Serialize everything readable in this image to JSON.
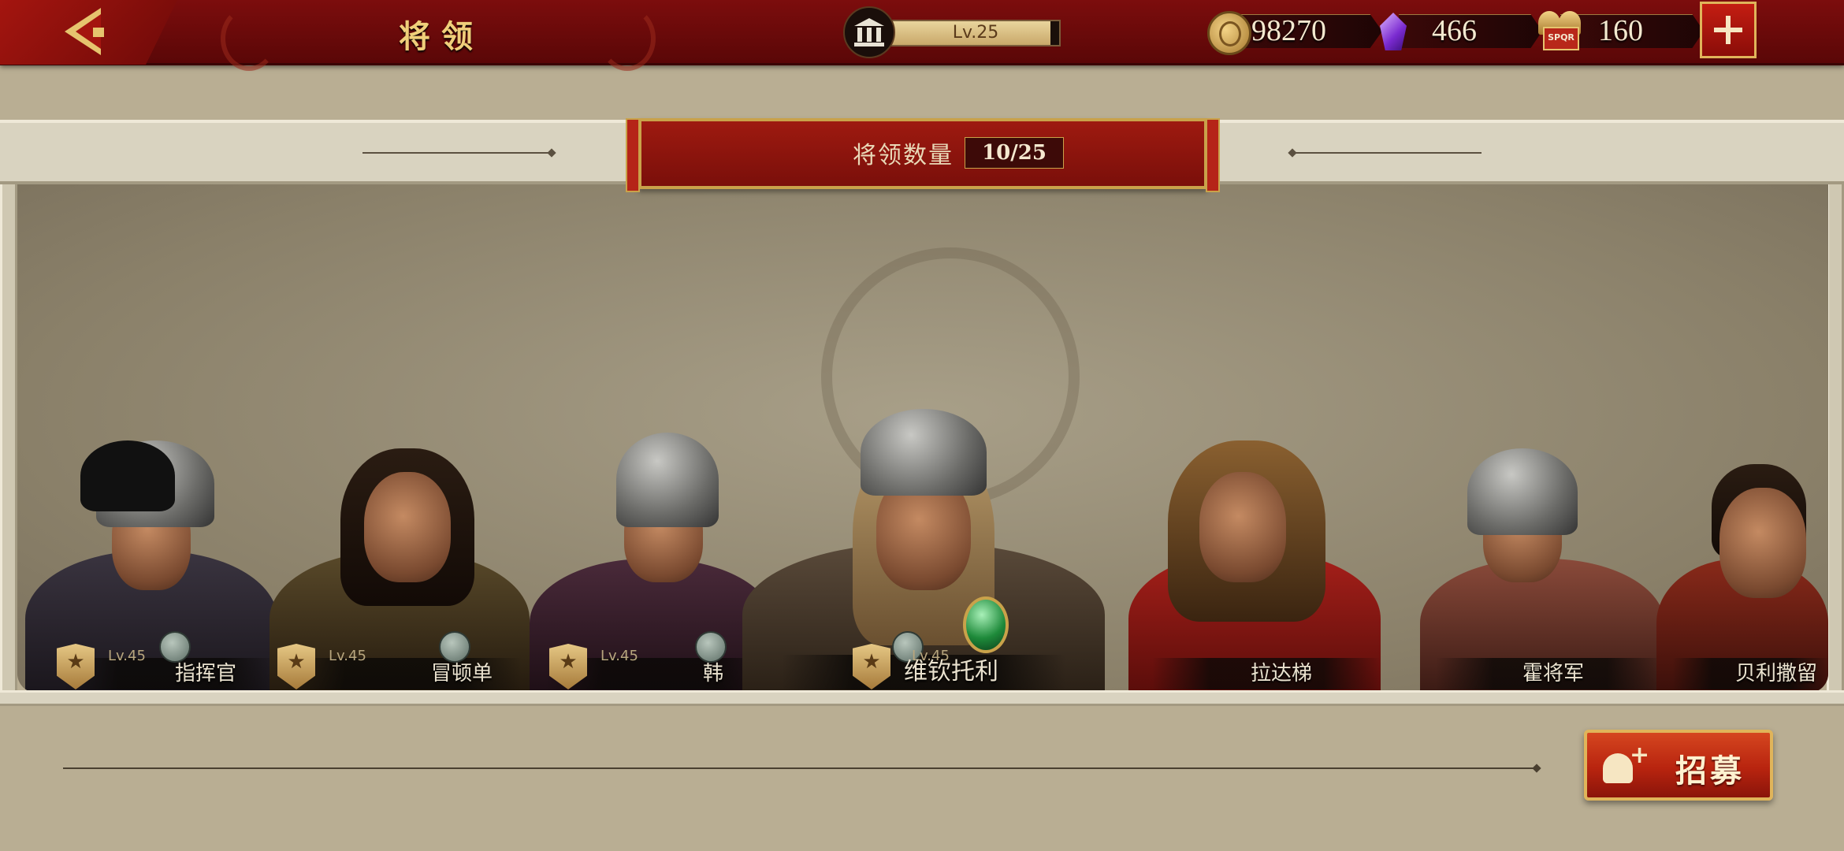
{
  "header": {
    "title": "将领",
    "level": "Lv.25",
    "level_progress": 0.95,
    "resources": [
      {
        "name": "coins",
        "icon": "coin-icon",
        "value": "98270"
      },
      {
        "name": "gems",
        "icon": "purple-gem-icon",
        "value": "466"
      },
      {
        "name": "spqr",
        "icon": "spqr-helmet-icon",
        "value": "160"
      }
    ],
    "spqr_text": "SPQR"
  },
  "banner": {
    "label": "将领数量",
    "count": "10/25"
  },
  "generals": [
    {
      "name": "指挥官",
      "level": "Lv.45"
    },
    {
      "name": "冒顿单",
      "level": "Lv.45"
    },
    {
      "name": "韩",
      "level": "Lv.45"
    },
    {
      "name": "维钦托利",
      "level": "Lv.45"
    },
    {
      "name": "拉达梯",
      "level": ""
    },
    {
      "name": "霍将军",
      "level": ""
    },
    {
      "name": "贝利撒留",
      "level": ""
    }
  ],
  "recruit": {
    "label": "招募"
  },
  "colors": {
    "header_red": "#7c0d0d",
    "gold": "#c9a24a",
    "parchment": "#b9ae93",
    "recruit_orange": "#d5461f"
  }
}
